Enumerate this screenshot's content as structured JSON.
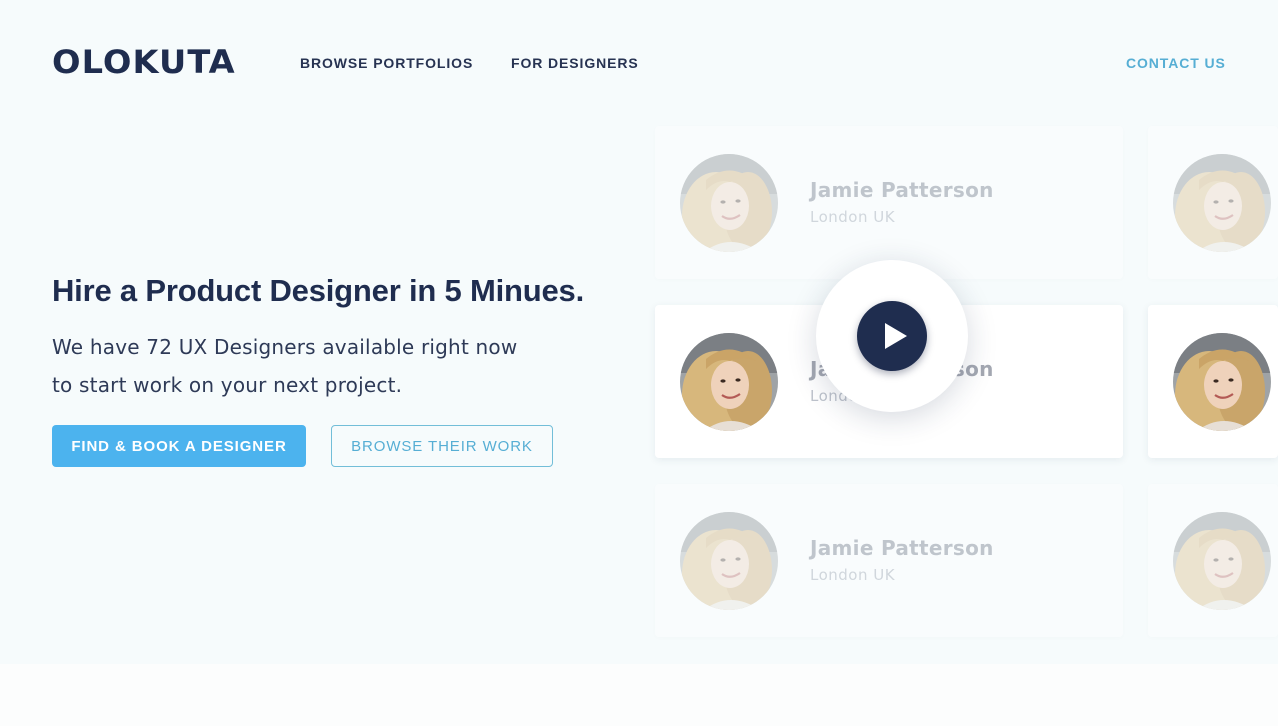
{
  "brand": {
    "logo": "OLOKUTA"
  },
  "nav": {
    "browse_portfolios": "BROWSE PORTFOLIOS",
    "for_designers": "FOR DESIGNERS",
    "contact_us": "CONTACT US"
  },
  "hero": {
    "headline": "Hire a Product Designer in 5 Minues.",
    "subline_1": "We have 72 UX Designers available right now",
    "subline_2": "to start work on your next project.",
    "primary_button": "FIND & BOOK A DESIGNER",
    "secondary_button": "BROWSE THEIR WORK"
  },
  "cards": [
    {
      "name": "Jamie Patterson",
      "location": "London UK"
    },
    {
      "name": "Jamie Patterson",
      "location": "London UK"
    },
    {
      "name": "Jamie Patterson",
      "location": "London UK"
    }
  ],
  "icons": {
    "play": "play-icon"
  },
  "colors": {
    "brand_navy": "#1f2d4f",
    "primary_blue": "#4cb3ee",
    "accent_teal": "#56aed4",
    "hero_bg": "#f6fbfc"
  }
}
